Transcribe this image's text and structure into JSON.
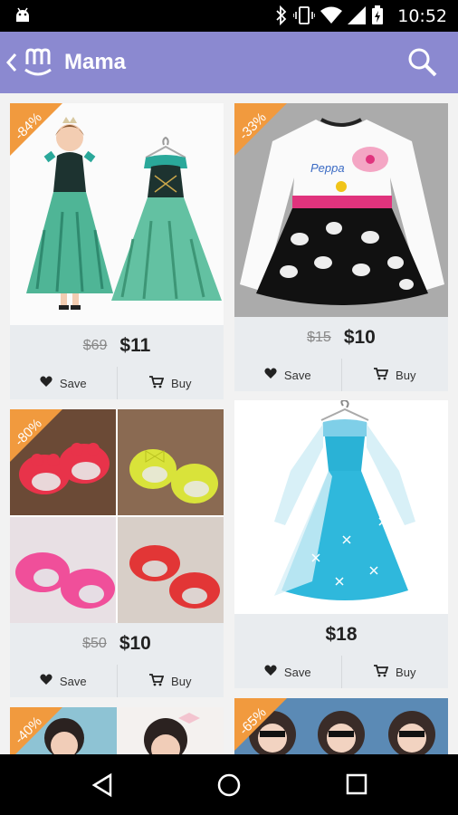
{
  "status_bar": {
    "time": "10:52",
    "icons": [
      "android-icon",
      "bluetooth-icon",
      "vibrate-icon",
      "wifi-icon",
      "signal-icon",
      "battery-icon"
    ]
  },
  "app_bar": {
    "title": "Mama",
    "back_icon": "chevron-left-icon",
    "logo_icon": "mama-logo-icon",
    "search_icon": "search-icon",
    "background": "#8b89d0"
  },
  "products": [
    {
      "id": "frozen-dress-girl",
      "discount": "-84%",
      "old_price": "$69",
      "price": "$11",
      "save_label": "Save",
      "buy_label": "Buy"
    },
    {
      "id": "peppa-dress",
      "discount": "-33%",
      "old_price": "$15",
      "price": "$10",
      "save_label": "Save",
      "buy_label": "Buy"
    },
    {
      "id": "kids-shoes",
      "discount": "-80%",
      "old_price": "$50",
      "price": "$10",
      "save_label": "Save",
      "buy_label": "Buy"
    },
    {
      "id": "elsa-dress",
      "discount": "",
      "old_price": "",
      "price": "$18",
      "save_label": "Save",
      "buy_label": "Buy"
    },
    {
      "id": "girl-hair-bow",
      "discount": "-40%"
    },
    {
      "id": "girl-sunglasses",
      "discount": "-65%"
    }
  ],
  "colors": {
    "badge": "#f19a3e",
    "price_area": "#e9ecef"
  },
  "nav_bar": {
    "back_icon": "nav-back-icon",
    "home_icon": "nav-home-icon",
    "recents_icon": "nav-recents-icon"
  }
}
